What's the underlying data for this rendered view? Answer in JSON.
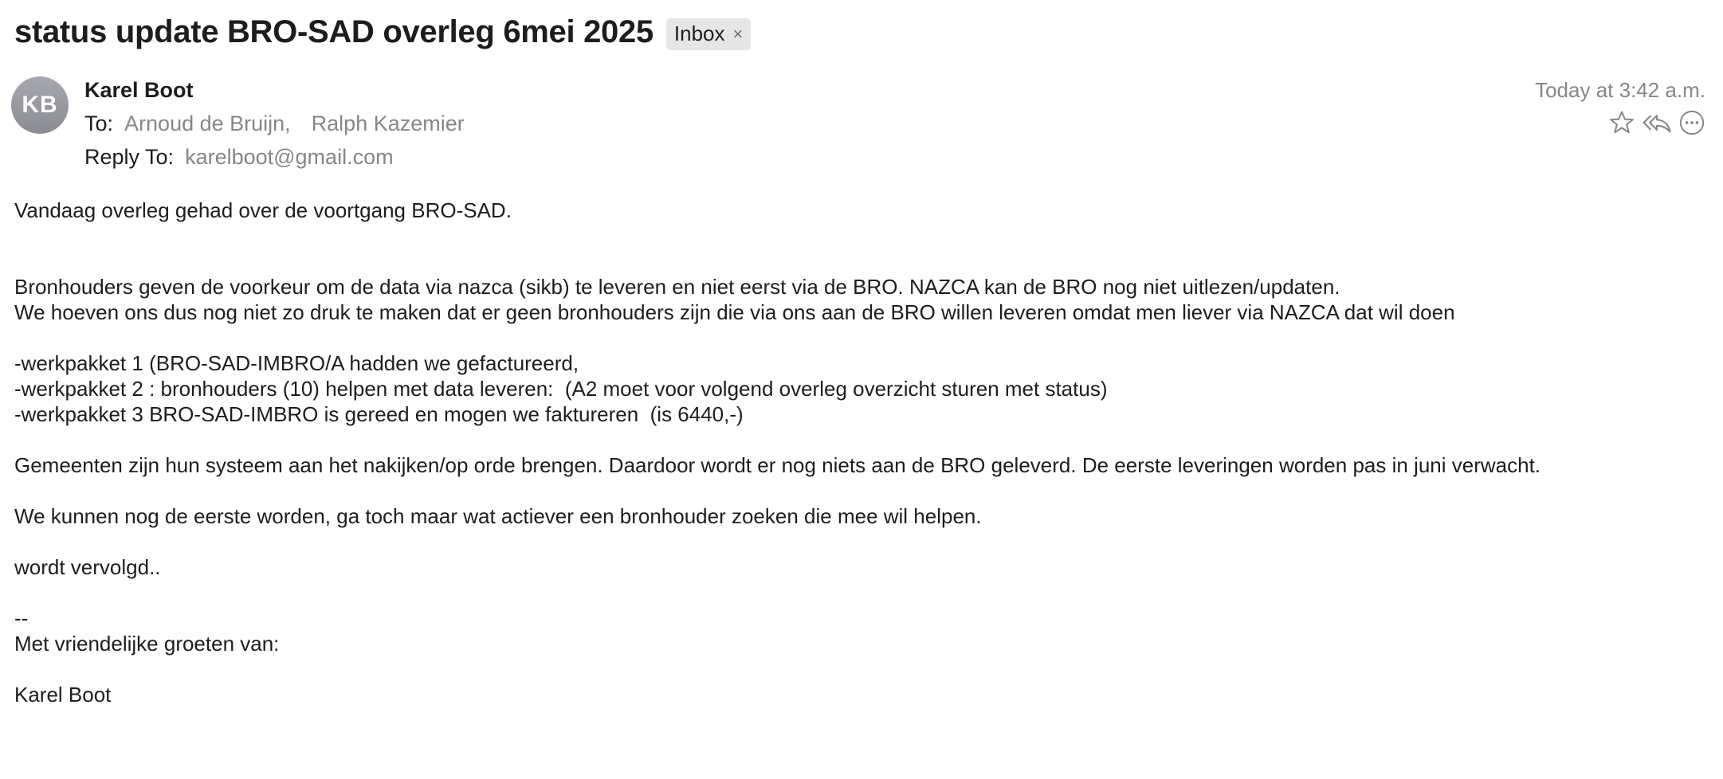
{
  "message": {
    "subject": "status update BRO-SAD overleg 6mei 2025",
    "mailbox_tag": "Inbox",
    "mailbox_tag_close": "×",
    "sender_initials": "KB",
    "sender_name": "Karel Boot",
    "to_label": "To:",
    "recipients": [
      "Arnoud de Bruijn,",
      "Ralph Kazemier"
    ],
    "reply_to_label": "Reply To:",
    "reply_to_value": "karelboot@gmail.com",
    "date": "Today at 3:42 a.m."
  },
  "actions": {
    "icons": [
      "star-icon",
      "reply-all-icon",
      "more-icon"
    ]
  },
  "body": {
    "lines": [
      "Vandaag overleg gehad over de voortgang BRO-SAD.",
      "",
      "",
      "Bronhouders geven de voorkeur om de data via nazca (sikb) te leveren en niet eerst via de BRO. NAZCA kan de BRO nog niet uitlezen/updaten.",
      "We hoeven ons dus nog niet zo druk te maken dat er geen bronhouders zijn die via ons aan de BRO willen leveren omdat men liever via NAZCA dat wil doen",
      "",
      "-werkpakket 1 (BRO-SAD-IMBRO/A hadden we gefactureerd,",
      "-werkpakket 2 : bronhouders (10) helpen met data leveren:  (A2 moet voor volgend overleg overzicht sturen met status)",
      "-werkpakket 3 BRO-SAD-IMBRO is gereed en mogen we faktureren  (is 6440,-)",
      "",
      "Gemeenten zijn hun systeem aan het nakijken/op orde brengen. Daardoor wordt er nog niets aan de BRO geleverd. De eerste leveringen worden pas in juni verwacht.",
      "",
      "We kunnen nog de eerste worden, ga toch maar wat actiever een bronhouder zoeken die mee wil helpen.",
      "",
      "wordt vervolgd..",
      "",
      "--",
      "Met vriendelijke groeten van:",
      "",
      "Karel Boot"
    ]
  }
}
